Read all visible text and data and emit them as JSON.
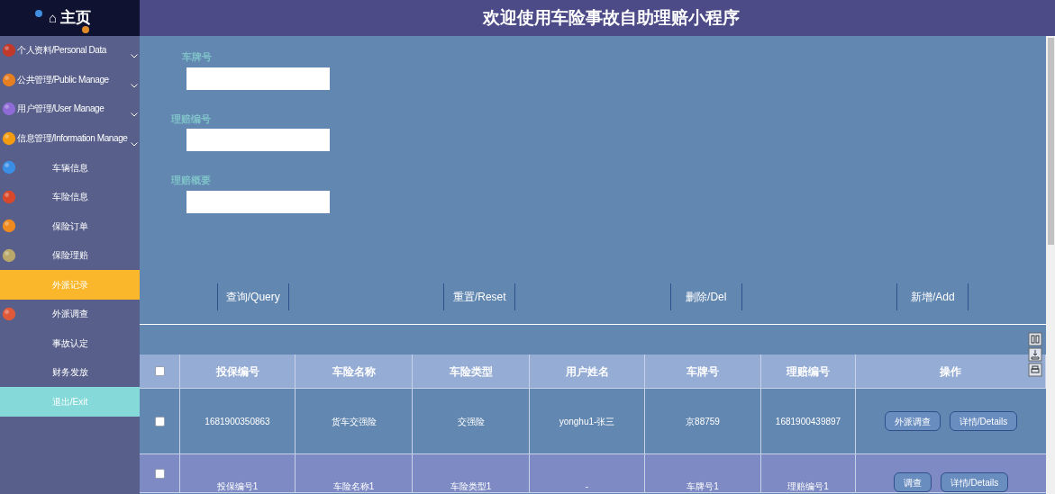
{
  "home": {
    "icon": "⌂",
    "label": "主页"
  },
  "title": "欢迎使用车险事故自助理赔小程序",
  "sidebar": {
    "items": [
      {
        "label": "个人资料/Personal Data",
        "kind": "menu",
        "selected": false
      },
      {
        "label": "公共管理/Public Manage",
        "kind": "menu",
        "selected": false
      },
      {
        "label": "用户管理/User Manage",
        "kind": "menu",
        "selected": false
      },
      {
        "label": "信息管理/Information Manage",
        "kind": "menu",
        "selected": false
      },
      {
        "label": "车辆信息",
        "kind": "link",
        "selected": false
      },
      {
        "label": "车险信息",
        "kind": "link",
        "selected": false
      },
      {
        "label": "保险订单",
        "kind": "link",
        "selected": false
      },
      {
        "label": "保险理赔",
        "kind": "link",
        "selected": false
      },
      {
        "label": "外派记录",
        "kind": "link",
        "selected": true
      },
      {
        "label": "外派调查",
        "kind": "link",
        "selected": false
      },
      {
        "label": "事故认定",
        "kind": "link",
        "selected": false
      },
      {
        "label": "财务发放",
        "kind": "link",
        "selected": false
      },
      {
        "label": "退出/Exit",
        "kind": "exit",
        "selected": false
      }
    ]
  },
  "filters": [
    {
      "label": "车牌号"
    },
    {
      "label": "理赔编号"
    },
    {
      "label": "理赔概要"
    }
  ],
  "buttons": [
    "查询/Query",
    "重置/Reset",
    "删除/Del",
    "新增/Add"
  ],
  "table": {
    "select_all": {
      "checked": false
    },
    "columns": [
      "投保编号",
      "车险名称",
      "车险类型",
      "用户姓名",
      "车牌号",
      "理赔编号",
      "操作"
    ],
    "rows": [
      {
        "checked": false,
        "cells": [
          "1681900350863",
          "货车交强险",
          "交强险",
          "yonghu1-张三",
          "京88759",
          "1681900439897"
        ],
        "actions": [
          "外派调查",
          "详情/Details"
        ]
      },
      {
        "checked": false,
        "cells": [
          "投保编号1",
          "车险名称1",
          "车险类型1",
          "-",
          "车牌号1",
          "理赔编号1"
        ],
        "actions": [
          "调查",
          "详情/Details"
        ]
      }
    ]
  }
}
